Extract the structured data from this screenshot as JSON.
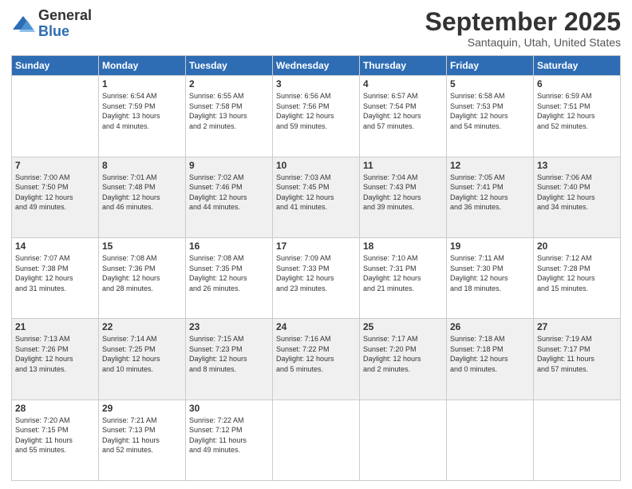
{
  "logo": {
    "general": "General",
    "blue": "Blue"
  },
  "header": {
    "month": "September 2025",
    "location": "Santaquin, Utah, United States"
  },
  "days_of_week": [
    "Sunday",
    "Monday",
    "Tuesday",
    "Wednesday",
    "Thursday",
    "Friday",
    "Saturday"
  ],
  "weeks": [
    [
      {
        "day": "",
        "info": ""
      },
      {
        "day": "1",
        "info": "Sunrise: 6:54 AM\nSunset: 7:59 PM\nDaylight: 13 hours\nand 4 minutes."
      },
      {
        "day": "2",
        "info": "Sunrise: 6:55 AM\nSunset: 7:58 PM\nDaylight: 13 hours\nand 2 minutes."
      },
      {
        "day": "3",
        "info": "Sunrise: 6:56 AM\nSunset: 7:56 PM\nDaylight: 12 hours\nand 59 minutes."
      },
      {
        "day": "4",
        "info": "Sunrise: 6:57 AM\nSunset: 7:54 PM\nDaylight: 12 hours\nand 57 minutes."
      },
      {
        "day": "5",
        "info": "Sunrise: 6:58 AM\nSunset: 7:53 PM\nDaylight: 12 hours\nand 54 minutes."
      },
      {
        "day": "6",
        "info": "Sunrise: 6:59 AM\nSunset: 7:51 PM\nDaylight: 12 hours\nand 52 minutes."
      }
    ],
    [
      {
        "day": "7",
        "info": "Sunrise: 7:00 AM\nSunset: 7:50 PM\nDaylight: 12 hours\nand 49 minutes."
      },
      {
        "day": "8",
        "info": "Sunrise: 7:01 AM\nSunset: 7:48 PM\nDaylight: 12 hours\nand 46 minutes."
      },
      {
        "day": "9",
        "info": "Sunrise: 7:02 AM\nSunset: 7:46 PM\nDaylight: 12 hours\nand 44 minutes."
      },
      {
        "day": "10",
        "info": "Sunrise: 7:03 AM\nSunset: 7:45 PM\nDaylight: 12 hours\nand 41 minutes."
      },
      {
        "day": "11",
        "info": "Sunrise: 7:04 AM\nSunset: 7:43 PM\nDaylight: 12 hours\nand 39 minutes."
      },
      {
        "day": "12",
        "info": "Sunrise: 7:05 AM\nSunset: 7:41 PM\nDaylight: 12 hours\nand 36 minutes."
      },
      {
        "day": "13",
        "info": "Sunrise: 7:06 AM\nSunset: 7:40 PM\nDaylight: 12 hours\nand 34 minutes."
      }
    ],
    [
      {
        "day": "14",
        "info": "Sunrise: 7:07 AM\nSunset: 7:38 PM\nDaylight: 12 hours\nand 31 minutes."
      },
      {
        "day": "15",
        "info": "Sunrise: 7:08 AM\nSunset: 7:36 PM\nDaylight: 12 hours\nand 28 minutes."
      },
      {
        "day": "16",
        "info": "Sunrise: 7:08 AM\nSunset: 7:35 PM\nDaylight: 12 hours\nand 26 minutes."
      },
      {
        "day": "17",
        "info": "Sunrise: 7:09 AM\nSunset: 7:33 PM\nDaylight: 12 hours\nand 23 minutes."
      },
      {
        "day": "18",
        "info": "Sunrise: 7:10 AM\nSunset: 7:31 PM\nDaylight: 12 hours\nand 21 minutes."
      },
      {
        "day": "19",
        "info": "Sunrise: 7:11 AM\nSunset: 7:30 PM\nDaylight: 12 hours\nand 18 minutes."
      },
      {
        "day": "20",
        "info": "Sunrise: 7:12 AM\nSunset: 7:28 PM\nDaylight: 12 hours\nand 15 minutes."
      }
    ],
    [
      {
        "day": "21",
        "info": "Sunrise: 7:13 AM\nSunset: 7:26 PM\nDaylight: 12 hours\nand 13 minutes."
      },
      {
        "day": "22",
        "info": "Sunrise: 7:14 AM\nSunset: 7:25 PM\nDaylight: 12 hours\nand 10 minutes."
      },
      {
        "day": "23",
        "info": "Sunrise: 7:15 AM\nSunset: 7:23 PM\nDaylight: 12 hours\nand 8 minutes."
      },
      {
        "day": "24",
        "info": "Sunrise: 7:16 AM\nSunset: 7:22 PM\nDaylight: 12 hours\nand 5 minutes."
      },
      {
        "day": "25",
        "info": "Sunrise: 7:17 AM\nSunset: 7:20 PM\nDaylight: 12 hours\nand 2 minutes."
      },
      {
        "day": "26",
        "info": "Sunrise: 7:18 AM\nSunset: 7:18 PM\nDaylight: 12 hours\nand 0 minutes."
      },
      {
        "day": "27",
        "info": "Sunrise: 7:19 AM\nSunset: 7:17 PM\nDaylight: 11 hours\nand 57 minutes."
      }
    ],
    [
      {
        "day": "28",
        "info": "Sunrise: 7:20 AM\nSunset: 7:15 PM\nDaylight: 11 hours\nand 55 minutes."
      },
      {
        "day": "29",
        "info": "Sunrise: 7:21 AM\nSunset: 7:13 PM\nDaylight: 11 hours\nand 52 minutes."
      },
      {
        "day": "30",
        "info": "Sunrise: 7:22 AM\nSunset: 7:12 PM\nDaylight: 11 hours\nand 49 minutes."
      },
      {
        "day": "",
        "info": ""
      },
      {
        "day": "",
        "info": ""
      },
      {
        "day": "",
        "info": ""
      },
      {
        "day": "",
        "info": ""
      }
    ]
  ]
}
